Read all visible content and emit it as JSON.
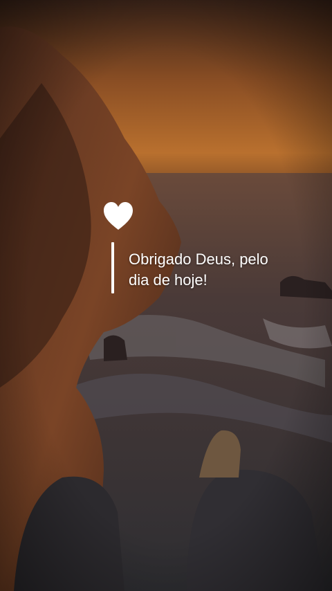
{
  "caption": {
    "line1": "Obrigado Deus, pelo",
    "line2": "dia de hoje!"
  },
  "icon": "heart-icon",
  "colors": {
    "sky_top": "#3a2418",
    "sky_glow": "#b9702e",
    "sea": "#3c3a3c",
    "cliff": "#6b3a22",
    "text": "#ffffff"
  }
}
